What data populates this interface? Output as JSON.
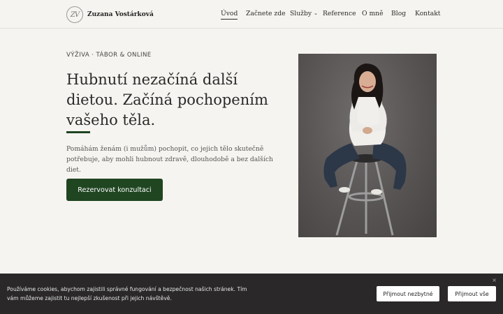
{
  "header": {
    "logo_mark": "ZV",
    "site_name": "Zuzana Vostárková",
    "nav": [
      {
        "label": "Úvod",
        "active": true
      },
      {
        "label": "Začnete zde"
      },
      {
        "label": "Služby",
        "dropdown": true
      },
      {
        "label": "Reference"
      },
      {
        "label": "O mně"
      },
      {
        "label": "Blog"
      },
      {
        "label": "Kontakt"
      }
    ]
  },
  "hero": {
    "eyebrow": "VÝŽIVA · TÁBOR & ONLINE",
    "headline": "Hubnutí nezačíná další dietou. Začíná pochopením vašeho těla.",
    "lead": "Pomáhám ženám (i mužům) pochopit, co jejich tělo skutečně potřebuje, aby mohli hubnout zdravě, dlouhodobě a bez dalších diet.",
    "cta_label": "Rezervovat konzultaci"
  },
  "cookie": {
    "text": "Používáme cookies, abychom zajistili správné fungování a bezpečnost našich stránek. Tím vám můžeme zajistit tu nejlepší zkušenost při jejich návštěvě.",
    "close_icon": "×",
    "btn_necessary": "Přijmout nezbytné",
    "btn_all": "Přijmout vše"
  },
  "colors": {
    "accent": "#1f4521",
    "background": "#f6f4f0",
    "cookie_bar": "#2a2828"
  },
  "icons": [
    "logo-monogram",
    "chevron-down-icon",
    "close-icon"
  ]
}
